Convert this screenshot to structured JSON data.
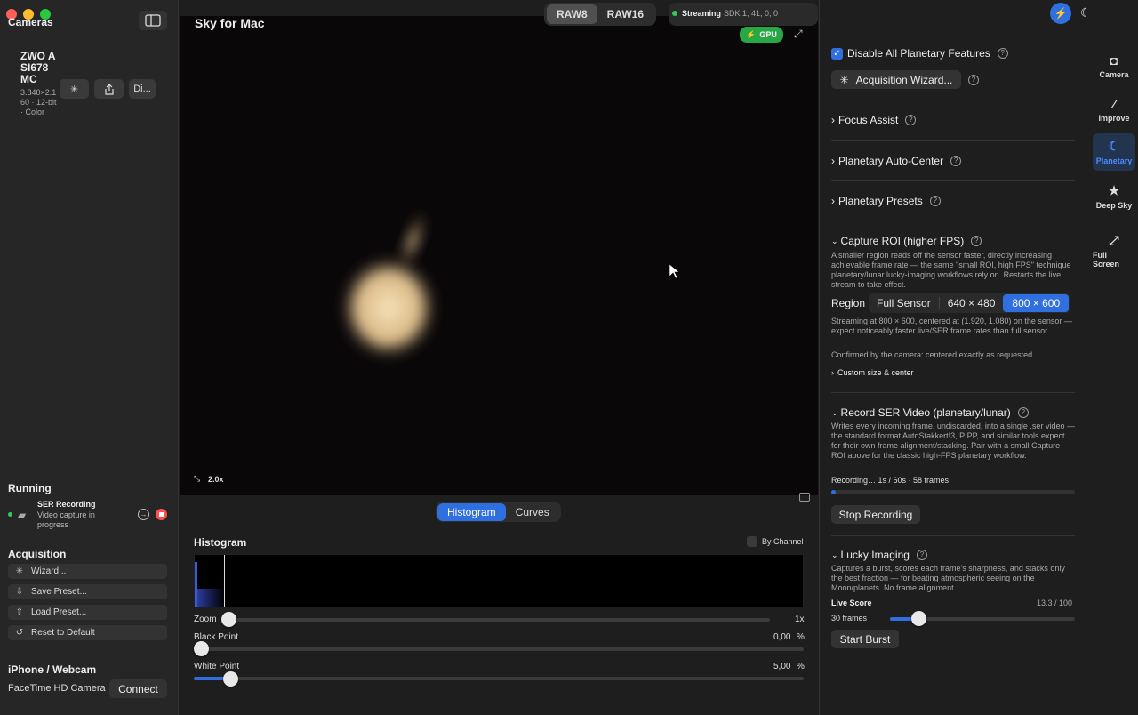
{
  "app": {
    "title": "Sky for Mac"
  },
  "sidebar": {
    "cameras_title": "Cameras",
    "camera": {
      "name": "ZWO ASI678MC",
      "details": "3.840×2.160 · 12-bit · Color",
      "more_label": "Di..."
    },
    "running_title": "Running",
    "running_task": {
      "title": "SER Recording",
      "subtitle": "Video capture in progress"
    },
    "acquisition_title": "Acquisition",
    "acquisition_items": [
      "Wizard...",
      "Save Preset...",
      "Load Preset...",
      "Reset to Default"
    ],
    "webcam_title": "iPhone / Webcam",
    "webcam_device": "FaceTime HD Camera",
    "connect_label": "Connect"
  },
  "topbar": {
    "formats": [
      "RAW8",
      "RAW16"
    ],
    "active_format": "RAW8",
    "status_label": "Streaming",
    "sdk_text": "SDK 1, 41, 0, 0",
    "gpu_label": "GPU"
  },
  "viewer": {
    "zoom_label": "2.0x"
  },
  "lower": {
    "tabs": [
      "Histogram",
      "Curves"
    ],
    "active_tab": "Histogram",
    "histogram_title": "Histogram",
    "by_channel_label": "By Channel",
    "zoom": {
      "label": "Zoom",
      "value": "1x",
      "fraction": 0.0
    },
    "black_point": {
      "label": "Black Point",
      "value": "0,00",
      "unit": "%",
      "fraction": 0.0
    },
    "white_point": {
      "label": "White Point",
      "value": "5,00",
      "unit": "%",
      "fraction": 0.05
    }
  },
  "right": {
    "disable_all_label": "Disable All Planetary Features",
    "disable_all_checked": true,
    "wizard_button": "Acquisition Wizard...",
    "sections": [
      "Focus Assist",
      "Planetary Auto-Center",
      "Planetary Presets"
    ],
    "roi": {
      "title": "Capture ROI (higher FPS)",
      "description": "A smaller region reads off the sensor faster, directly increasing achievable frame rate — the same \"small ROI, high FPS\" technique planetary/lunar lucky-imaging workflows rely on. Restarts the live stream to take effect.",
      "region_label": "Region",
      "options": [
        "Full Sensor",
        "640 × 480",
        "800 × 600"
      ],
      "selected": "800 × 600",
      "status": "Streaming at 800 × 600, centered at (1.920, 1.080) on the sensor — expect noticeably faster live/SER frame rates than full sensor.",
      "confirmation": "Confirmed by the camera: centered exactly as requested.",
      "custom_label": "Custom size & center"
    },
    "ser": {
      "title": "Record SER Video (planetary/lunar)",
      "description": "Writes every incoming frame, undiscarded, into a single .ser video — the standard format AutoStakkert!3, PIPP, and similar tools expect for their own frame alignment/stacking. Pair with a small Capture ROI above for the classic high-FPS planetary workflow.",
      "progress_text": "Recording… 1s / 60s · 58 frames",
      "progress": 0.017,
      "stop_label": "Stop Recording"
    },
    "lucky": {
      "title": "Lucky Imaging",
      "description": "Captures a burst, scores each frame's sharpness, and stacks only the best fraction — for beating atmospheric seeing on the Moon/planets. No frame alignment.",
      "live_score_label": "Live Score",
      "live_score_value": "13.3 / 100",
      "frames_label": "30 frames",
      "frames_fraction": 0.16,
      "start_label": "Start Burst"
    }
  },
  "rail": {
    "tabs": [
      {
        "label": "Camera",
        "icon": "camera-icon"
      },
      {
        "label": "Improve",
        "icon": "magic-wand-icon"
      },
      {
        "label": "Planetary",
        "icon": "moon-icon"
      },
      {
        "label": "Deep Sky",
        "icon": "star-icon"
      },
      {
        "label": "Full Screen",
        "icon": "expand-icon"
      }
    ],
    "active": "Planetary"
  },
  "colors": {
    "accent": "#2f6fe0",
    "green": "#34c759",
    "red": "#ff4f4f"
  }
}
